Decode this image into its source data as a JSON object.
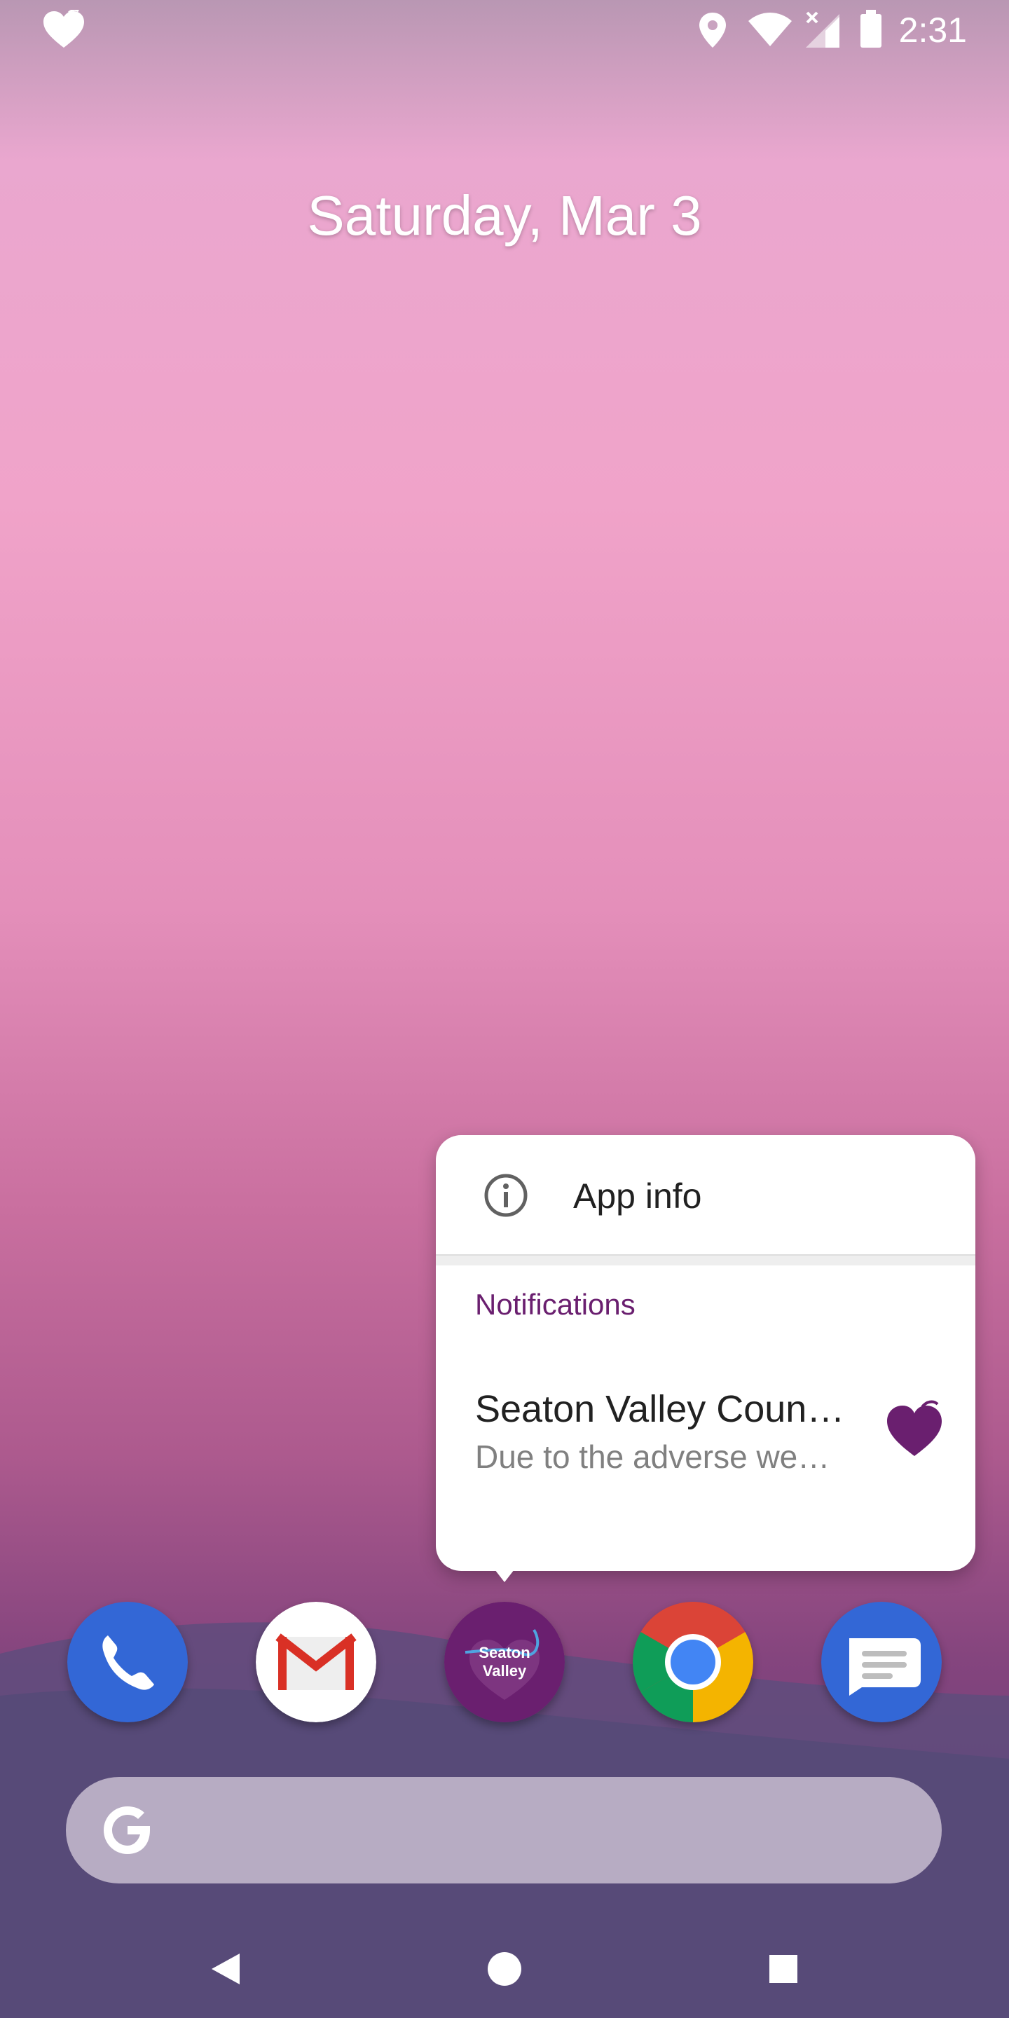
{
  "status_bar": {
    "time": "2:31",
    "icons": [
      "heart-icon",
      "location-icon",
      "wifi-icon",
      "signal-off-icon",
      "battery-icon"
    ]
  },
  "home": {
    "date": "Saturday, Mar 3"
  },
  "popup": {
    "app_info_label": "App info",
    "notifications_header": "Notifications",
    "notification": {
      "title": "Seaton Valley Coun…",
      "body": "Due to the adverse we…"
    }
  },
  "dock": {
    "apps": [
      {
        "name": "Phone",
        "icon": "phone-icon"
      },
      {
        "name": "Gmail",
        "icon": "gmail-icon"
      },
      {
        "name": "Seaton Valley",
        "icon": "seaton-valley-icon",
        "line1": "Seaton",
        "line2": "Valley"
      },
      {
        "name": "Chrome",
        "icon": "chrome-icon"
      },
      {
        "name": "Messages",
        "icon": "messages-icon"
      }
    ]
  },
  "colors": {
    "accent": "#6a1f6f",
    "phone_blue": "#3367d6",
    "gmail_red": "#d93025",
    "seaton_purple": "#6a1f6f"
  }
}
